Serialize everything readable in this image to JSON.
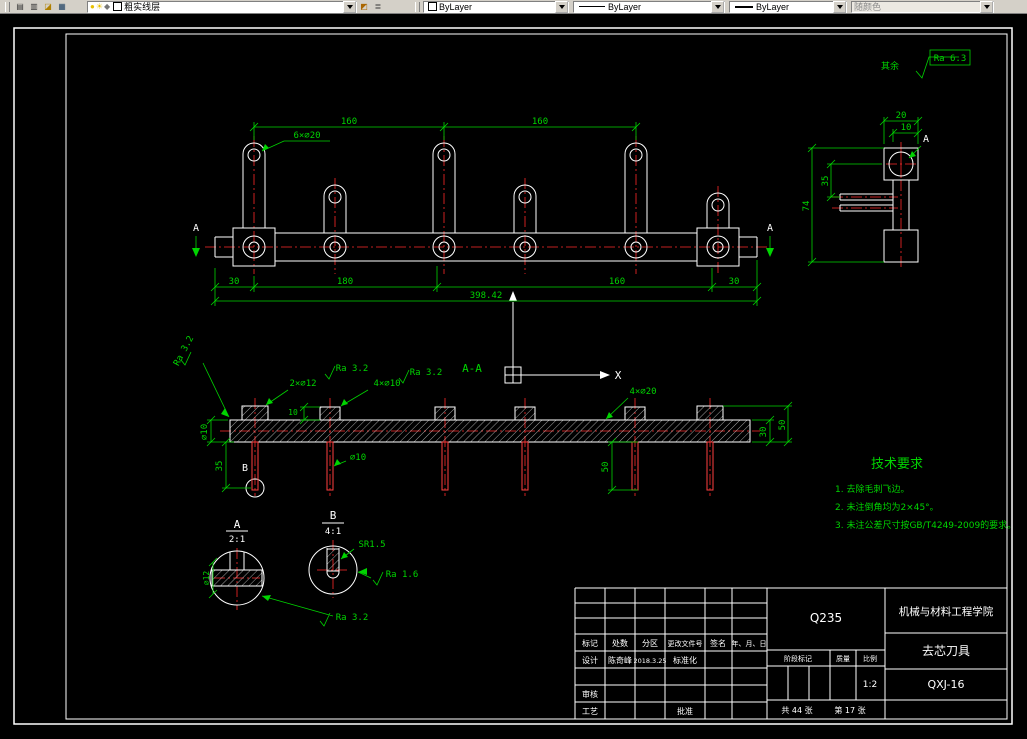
{
  "toolbar": {
    "layer_value": "粗实线层",
    "color_value": "ByLayer",
    "linetype_value": "ByLayer",
    "lineweight_value": "ByLayer",
    "plotstyle_value": "随颜色"
  },
  "drawing": {
    "surface_note_prefix": "其余",
    "surface_note_value": "Ra 6.3",
    "top_view": {
      "d160a": "160",
      "d160b": "160",
      "leader_6x20": "6×∅20",
      "sec_a_left": "A",
      "sec_a_right": "A",
      "d30l": "30",
      "d180": "180",
      "d160c": "160",
      "d30r": "30",
      "total": "398.42"
    },
    "right_view": {
      "d20": "20",
      "d10": "10",
      "d35": "35",
      "d74": "74",
      "label_a": "A"
    },
    "section_view": {
      "label": "A-A",
      "ra_left": "Ra 3.2",
      "d10_left": "∅10",
      "d2x12": "2×∅12",
      "ra_mid1": "Ra 3.2",
      "d4x10": "4×∅10",
      "ra_mid2": "Ra 3.2",
      "d4x20": "4×∅20",
      "d10_block": "10",
      "d35_pin": "35",
      "d10_pin": "∅10",
      "d50_pin": "50",
      "d30_right": "30",
      "d50_right": "50",
      "label_b": "B",
      "axis_x": "X"
    },
    "detail_a": {
      "label": "A",
      "scale": "2:1",
      "dim": "∅12",
      "ra": "Ra 3.2"
    },
    "detail_b": {
      "label": "B",
      "scale": "4:1",
      "sr": "SR1.5",
      "ra": "Ra 1.6"
    },
    "tech_req": {
      "title": "技术要求",
      "item1": "1. 去除毛刺飞边。",
      "item2": "2. 未注倒角均为2×45°。",
      "item3": "3. 未注公差尺寸按GB/T4249-2009的要求。"
    }
  },
  "title_block": {
    "material": "Q235",
    "school": "机械与材料工程学院",
    "part_name": "去芯刀具",
    "drawing_no": "QXJ-16",
    "col_mark": "标记",
    "col_count": "处数",
    "col_zone": "分区",
    "col_change": "更改文件号",
    "col_sign": "签名",
    "col_date": "年、月、日",
    "design": "设计",
    "designer": "陈奇峰",
    "date": "2018.3.25",
    "standard": "标准化",
    "check": "审核",
    "process": "工艺",
    "approve": "批准",
    "stage": "阶段标记",
    "weight": "质量",
    "scale": "比例",
    "scale_value": "1:2",
    "sheets_total": "共 44 张",
    "sheet_no": "第 17 张"
  }
}
